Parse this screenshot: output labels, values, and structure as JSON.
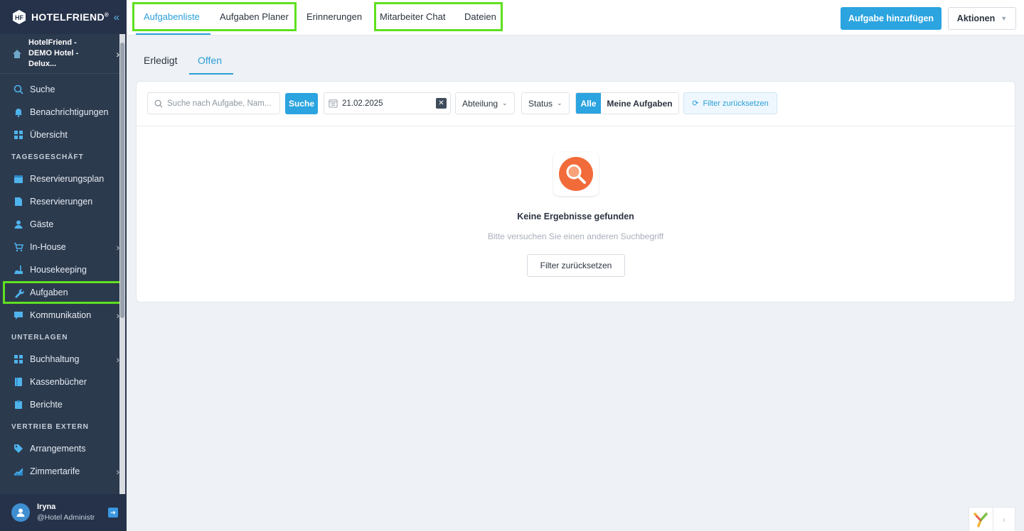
{
  "brand": {
    "name": "HOTELFRIEND",
    "sup": "®"
  },
  "hotel": {
    "name": "HotelFriend - DEMO Hotel - Delux..."
  },
  "sidebar": {
    "items": [
      {
        "label": "Suche",
        "icon": "search-icon"
      },
      {
        "label": "Benachrichtigungen",
        "icon": "bell-icon"
      },
      {
        "label": "Übersicht",
        "icon": "dashboard-icon"
      }
    ],
    "section1": "TAGESGESCHÄFT",
    "daily": [
      {
        "label": "Reservierungsplan",
        "icon": "calendar-icon"
      },
      {
        "label": "Reservierungen",
        "icon": "document-icon"
      },
      {
        "label": "Gäste",
        "icon": "user-icon"
      },
      {
        "label": "In-House",
        "icon": "cart-icon"
      },
      {
        "label": "Housekeeping",
        "icon": "broom-icon"
      },
      {
        "label": "Aufgaben",
        "icon": "wrench-icon"
      },
      {
        "label": "Kommunikation",
        "icon": "chat-icon"
      }
    ],
    "section2": "UNTERLAGEN",
    "docs": [
      {
        "label": "Buchhaltung",
        "icon": "grid-icon"
      },
      {
        "label": "Kassenbücher",
        "icon": "book-icon"
      },
      {
        "label": "Berichte",
        "icon": "clipboard-icon"
      }
    ],
    "section3": "VERTRIEB EXTERN",
    "sales": [
      {
        "label": "Arrangements",
        "icon": "tag-icon"
      },
      {
        "label": "Zimmertarife",
        "icon": "chart-icon"
      }
    ]
  },
  "user": {
    "name": "Iryna",
    "role": "@Hotel Administr"
  },
  "tabs": [
    "Aufgabenliste",
    "Aufgaben Planer",
    "Erinnerungen",
    "Mitarbeiter Chat",
    "Dateien"
  ],
  "actions": {
    "add": "Aufgabe hinzufügen",
    "actions": "Aktionen"
  },
  "subtabs": [
    "Erledigt",
    "Offen"
  ],
  "filters": {
    "search_placeholder": "Suche nach Aufgabe, Nam...",
    "search_button": "Suche",
    "date": "21.02.2025",
    "department": "Abteilung",
    "status": "Status",
    "all": "Alle",
    "mine": "Meine Aufgaben",
    "reset": "Filter zurücksetzen"
  },
  "empty": {
    "title": "Keine Ergebnisse gefunden",
    "subtitle": "Bitte versuchen Sie einen anderen Suchbegriff",
    "button": "Filter zurücksetzen"
  },
  "colors": {
    "accent": "#2ba4e0",
    "sidebar": "#2c3a4e",
    "highlight": "#5fe01f",
    "empty_icon": "#f26b3a"
  }
}
